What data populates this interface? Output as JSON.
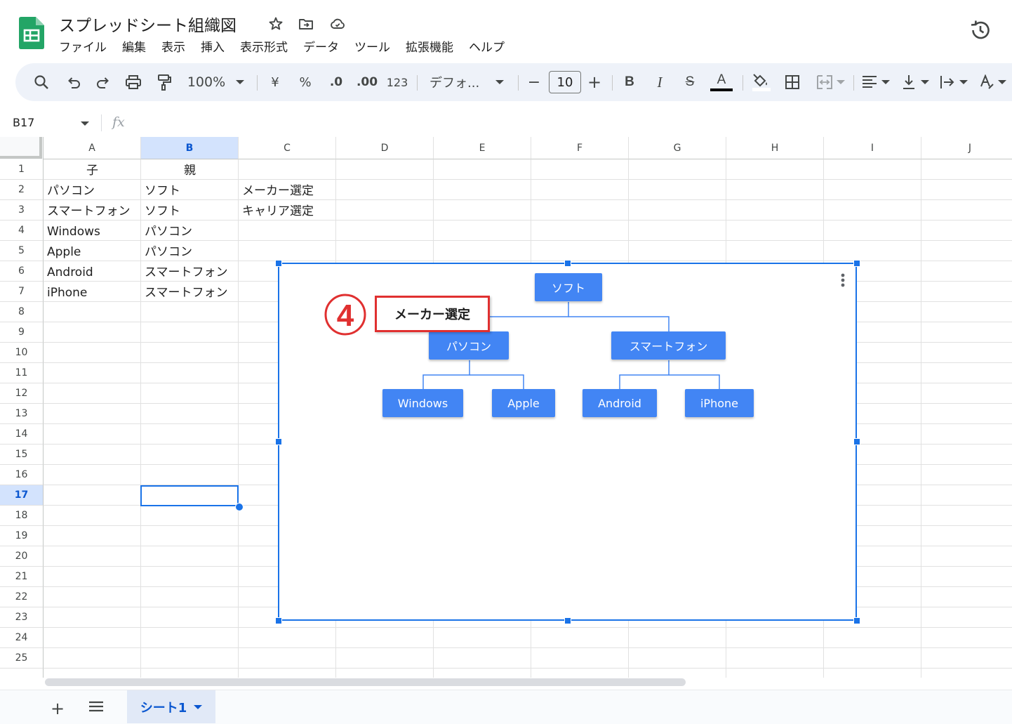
{
  "app": {
    "doc_title": "スプレッドシート組織図"
  },
  "menu": [
    "ファイル",
    "編集",
    "表示",
    "挿入",
    "表示形式",
    "データ",
    "ツール",
    "拡張機能",
    "ヘルプ"
  ],
  "toolbar": {
    "zoom": "100%",
    "currency": "¥",
    "percent": "%",
    "dec_decrease": ".0",
    "dec_increase": ".00",
    "number_format": "123",
    "font": "デフォ...",
    "font_size": "10",
    "minus": "−",
    "plus": "+",
    "bold": "B",
    "italic": "I",
    "strike": "S",
    "text_color_label": "A",
    "font_color": "#000000"
  },
  "formula_bar": {
    "cell_ref": "B17",
    "fx": "fx"
  },
  "grid": {
    "columns": [
      "A",
      "B",
      "C",
      "D",
      "E",
      "F",
      "G",
      "H",
      "I",
      "J"
    ],
    "selected_column": "B",
    "rows": [
      "1",
      "2",
      "3",
      "4",
      "5",
      "6",
      "7",
      "8",
      "9",
      "10",
      "11",
      "12",
      "13",
      "14",
      "15",
      "16",
      "17",
      "18",
      "19",
      "20",
      "21",
      "22",
      "23",
      "24",
      "25"
    ],
    "selected_row": "17",
    "cells": {
      "A1": "子",
      "B1": "親",
      "A2": "パソコン",
      "B2": "ソフト",
      "C2": "メーカー選定",
      "A3": "スマートフォン",
      "B3": "ソフト",
      "C3": "キャリア選定",
      "A4": "Windows",
      "B4": "パソコン",
      "A5": "Apple",
      "B5": "パソコン",
      "A6": "Android",
      "B6": "スマートフォン",
      "A7": "iPhone",
      "B7": "スマートフォン"
    }
  },
  "chart": {
    "nodes": {
      "root": "ソフト",
      "pc": "パソコン",
      "smartphone": "スマートフォン",
      "windows": "Windows",
      "apple": "Apple",
      "android": "Android",
      "iphone": "iPhone"
    },
    "node_color": "#4285f4",
    "line_color": "#4285f4"
  },
  "annotation": {
    "step_number": "4",
    "tooltip_text": "メーカー選定",
    "color": "#e03030"
  },
  "footer": {
    "add_sheet": "+",
    "sheet_tab": "シート1"
  }
}
